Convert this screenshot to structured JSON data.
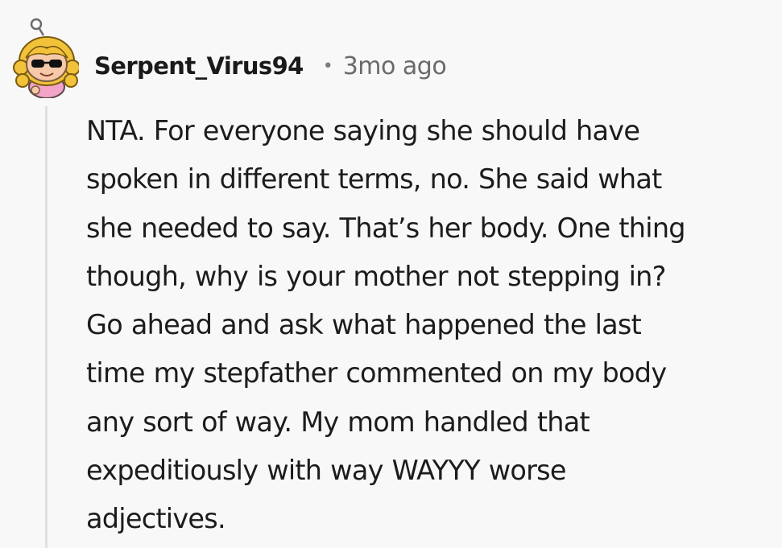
{
  "comment": {
    "username": "Serpent_Virus94",
    "separator": "•",
    "timestamp": "3mo ago",
    "body_lines": [
      "NTA. For everyone saying she should have",
      "spoken in different terms, no. She said what",
      "she needed to say. That’s her body. One thing",
      "though, why is your mother not stepping in?",
      "Go ahead and ask what happened the last",
      "time my stepfather commented on my body",
      "any sort of way. My mom handled that",
      "expeditiously with way WAYYY worse",
      "adjectives."
    ],
    "avatar": {
      "icon": "snoo-avatar-icon",
      "colors": {
        "hair": "#f2c23a",
        "skin": "#f6c9a8",
        "shirt": "#f2a3c7",
        "sunglasses": "#111111"
      }
    }
  }
}
